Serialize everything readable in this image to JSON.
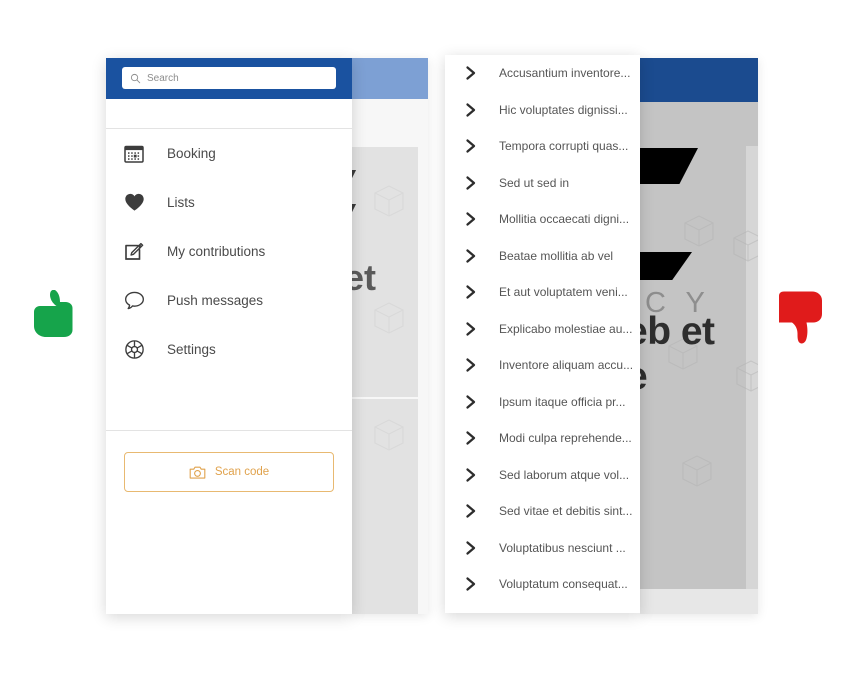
{
  "colors": {
    "header_blue": "#1a52a0",
    "bg_header_blue_light": "#7da0d4",
    "bg_header_blue_dark": "#1b4b8f",
    "scan_accent": "#e0a24c",
    "scan_border": "#e8b971",
    "thumb_up_green": "#16a44b",
    "thumb_down_red": "#e01b1b",
    "menu_text": "#4a4a4a",
    "list_text": "#555555",
    "placeholder_text": "#8d8d8d"
  },
  "left_panel": {
    "search": {
      "placeholder": "Search",
      "value": "",
      "icon": "search-icon"
    },
    "menu_items": [
      {
        "label": "Booking",
        "icon": "calendar-icon"
      },
      {
        "label": "Lists",
        "icon": "heart-icon"
      },
      {
        "label": "My contributions",
        "icon": "edit-square-icon"
      },
      {
        "label": "Push messages",
        "icon": "speech-bubble-icon"
      },
      {
        "label": "Settings",
        "icon": "gear-icon"
      }
    ],
    "scan_button": {
      "label": "Scan code",
      "icon": "camera-icon"
    }
  },
  "right_panel": {
    "items": [
      {
        "label": "Accusantium inventore...",
        "icon": "chevron-right-icon"
      },
      {
        "label": "Hic voluptates dignissi...",
        "icon": "chevron-right-icon"
      },
      {
        "label": "Tempora corrupti quas...",
        "icon": "chevron-right-icon"
      },
      {
        "label": "Sed ut sed in",
        "icon": "chevron-right-icon"
      },
      {
        "label": "Mollitia occaecati digni...",
        "icon": "chevron-right-icon"
      },
      {
        "label": "Beatae mollitia ab vel",
        "icon": "chevron-right-icon"
      },
      {
        "label": "Et aut voluptatem veni...",
        "icon": "chevron-right-icon"
      },
      {
        "label": "Explicabo molestiae au...",
        "icon": "chevron-right-icon"
      },
      {
        "label": "Inventore aliquam accu...",
        "icon": "chevron-right-icon"
      },
      {
        "label": "Ipsum itaque officia pr...",
        "icon": "chevron-right-icon"
      },
      {
        "label": "Modi culpa reprehende...",
        "icon": "chevron-right-icon"
      },
      {
        "label": "Sed laborum atque vol...",
        "icon": "chevron-right-icon"
      },
      {
        "label": "Sed vitae et debitis sint...",
        "icon": "chevron-right-icon"
      },
      {
        "label": "Voluptatibus nesciunt ...",
        "icon": "chevron-right-icon"
      },
      {
        "label": "Voluptatum consequat...",
        "icon": "chevron-right-icon"
      }
    ]
  },
  "background_left": {
    "fragment_text": "et"
  },
  "background_right": {
    "brand_text": "C Y",
    "fragment_line_1": "eb et",
    "fragment_line_2": "e"
  },
  "annotations": {
    "approve": {
      "icon": "thumbs-up-icon",
      "meaning": "good"
    },
    "reject": {
      "icon": "thumbs-down-icon",
      "meaning": "bad"
    }
  }
}
